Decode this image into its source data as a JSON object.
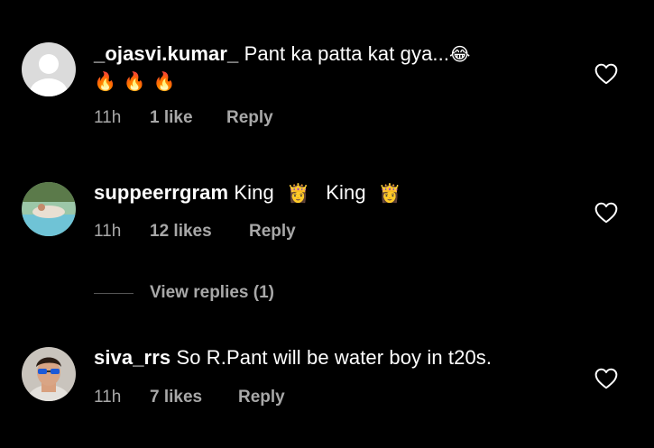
{
  "comments": [
    {
      "username": "_ojasvi.kumar_",
      "text": "Pant ka patta kat gya...",
      "text_emoji": "😂",
      "second_line_emoji": "🔥🔥🔥",
      "time": "11h",
      "likes": "1 like",
      "reply_label": "Reply",
      "like_icon": "heart-outline-icon"
    },
    {
      "username": "suppeerrgram",
      "text_parts": [
        "King",
        "👸",
        "King",
        "👸"
      ],
      "time": "11h",
      "likes": "12 likes",
      "reply_label": "Reply",
      "like_icon": "heart-outline-icon",
      "view_replies": "View replies (1)"
    },
    {
      "username": "siva_rrs",
      "text": "So R.Pant will be water boy in t20s.",
      "time": "11h",
      "likes": "7 likes",
      "reply_label": "Reply",
      "like_icon": "heart-outline-icon"
    }
  ],
  "colors": {
    "background": "#000000",
    "text": "#ffffff",
    "meta": "#a8a8a8",
    "crown": "#e0b24a",
    "fire": "#f4771f"
  }
}
